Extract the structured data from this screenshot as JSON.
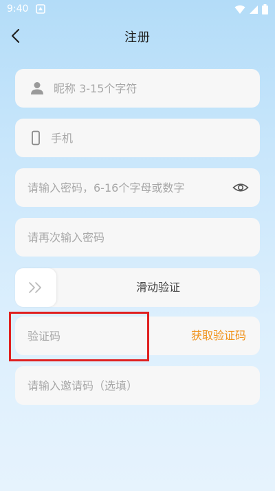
{
  "status_bar": {
    "time": "9:40"
  },
  "header": {
    "title": "注册"
  },
  "form": {
    "nickname_placeholder": "昵称 3-15个字符",
    "phone_placeholder": "手机",
    "password_placeholder": "请输入密码，6-16个字母或数字",
    "confirm_password_placeholder": "请再次输入密码",
    "slider_label": "滑动验证",
    "verification_code_placeholder": "验证码",
    "get_code_label": "获取验证码",
    "invite_code_placeholder": "请输入邀请码（选填）"
  },
  "colors": {
    "accent": "#f0921a",
    "highlight": "#e02020",
    "field_bg": "#f7f7f7"
  },
  "icons": [
    "notification-icon",
    "wifi-icon",
    "signal-icon",
    "battery-icon",
    "back-arrow-icon",
    "user-icon",
    "phone-icon",
    "eye-icon",
    "double-chevron-right-icon"
  ]
}
